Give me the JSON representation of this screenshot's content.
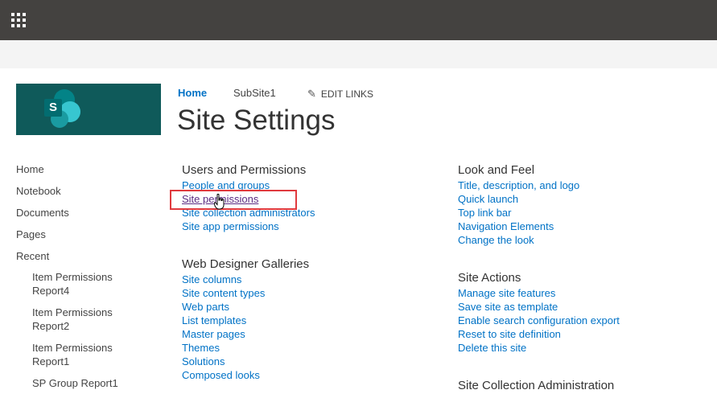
{
  "suite_bar": {
    "app_launcher_icon": "waffle-icon"
  },
  "logo": {
    "letter": "S",
    "icon": "sharepoint-logo"
  },
  "top_nav": {
    "home": "Home",
    "subsite": "SubSite1",
    "edit_links": "EDIT LINKS",
    "edit_icon": "pencil-icon"
  },
  "page_title": "Site Settings",
  "quick_launch": {
    "items": [
      "Home",
      "Notebook",
      "Documents",
      "Pages",
      "Recent"
    ],
    "recent": [
      [
        "Item Permissions",
        "Report4"
      ],
      [
        "Item Permissions",
        "Report2"
      ],
      [
        "Item Permissions",
        "Report1"
      ],
      [
        "SP Group Report1"
      ]
    ]
  },
  "sections": {
    "users_permissions": {
      "title": "Users and Permissions",
      "links": [
        "People and groups",
        "Site permissions",
        "Site collection administrators",
        "Site app permissions"
      ]
    },
    "web_designer": {
      "title": "Web Designer Galleries",
      "links": [
        "Site columns",
        "Site content types",
        "Web parts",
        "List templates",
        "Master pages",
        "Themes",
        "Solutions",
        "Composed looks"
      ]
    },
    "look_feel": {
      "title": "Look and Feel",
      "links": [
        "Title, description, and logo",
        "Quick launch",
        "Top link bar",
        "Navigation Elements",
        "Change the look"
      ]
    },
    "site_actions": {
      "title": "Site Actions",
      "links": [
        "Manage site features",
        "Save site as template",
        "Enable search configuration export",
        "Reset to site definition",
        "Delete this site"
      ]
    },
    "site_collection_admin": {
      "title": "Site Collection Administration"
    }
  },
  "colors": {
    "link": "#0072c6",
    "suite_bar": "#444240",
    "highlight": "#e03a3e",
    "logo_bg": "#0f5a5a"
  },
  "cursor_icon": "hand-pointer-icon"
}
